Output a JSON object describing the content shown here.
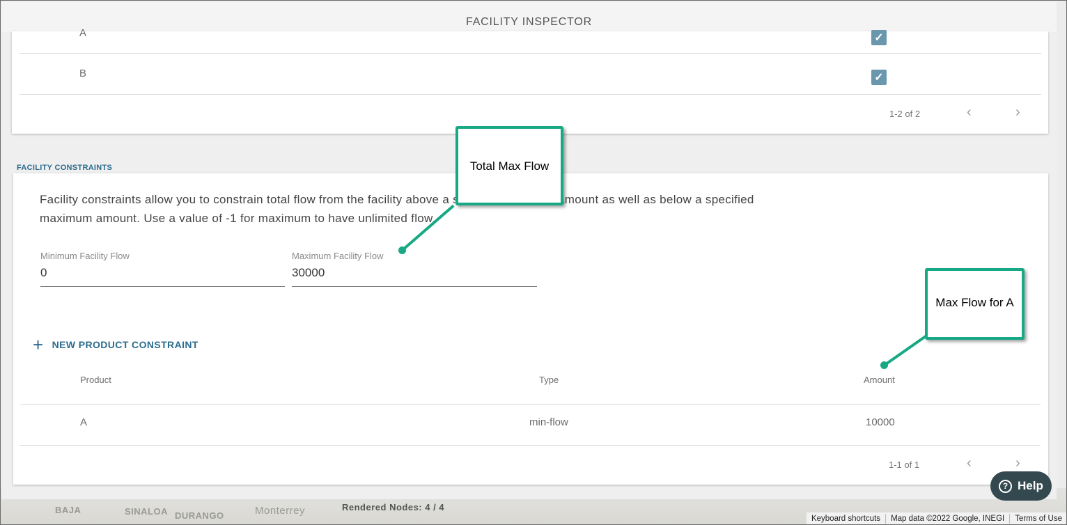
{
  "panel": {
    "title": "FACILITY INSPECTOR"
  },
  "products_table": {
    "rows": [
      {
        "name": "A",
        "checked": true
      },
      {
        "name": "B",
        "checked": true
      }
    ],
    "pagination": "1-2 of 2"
  },
  "constraints": {
    "section_label": "FACILITY CONSTRAINTS",
    "description": "Facility constraints allow you to constrain total flow from the facility above a specified minimum amount as well as below a specified maximum amount. Use a value of -1 for maximum to have unlimited flow.",
    "min_field": {
      "label": "Minimum Facility Flow",
      "value": "0"
    },
    "max_field": {
      "label": "Maximum Facility Flow",
      "value": "30000"
    },
    "new_button": "NEW PRODUCT CONSTRAINT",
    "table": {
      "headers": {
        "product": "Product",
        "type": "Type",
        "amount": "Amount"
      },
      "rows": [
        {
          "product": "A",
          "type": "min-flow",
          "amount": "10000"
        }
      ],
      "pagination": "1-1 of 1"
    }
  },
  "callouts": {
    "total": "Total Max Flow",
    "per_product": "Max Flow for A"
  },
  "help": {
    "label": "Help"
  },
  "map": {
    "labels": [
      "BAJA",
      "SINALOA",
      "DURANGO",
      "Monterrey",
      "Rendered Nodes: 4 / 4"
    ],
    "footer": [
      "Keyboard shortcuts",
      "Map data ©2022 Google, INEGI",
      "Terms of Use"
    ]
  },
  "colors": {
    "accent": "#2c6c8e",
    "callout": "#17a884",
    "checkbox": "#6a97ad"
  }
}
